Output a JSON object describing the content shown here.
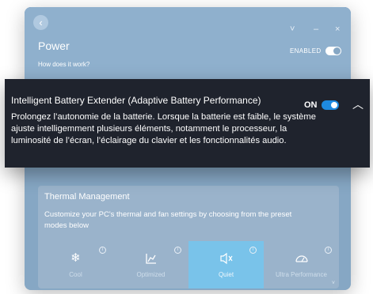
{
  "window": {
    "back_icon": "chevron-left-icon",
    "title": "Power",
    "help_link": "How does it work?",
    "enabled_label": "ENABLED",
    "controls": {
      "collapse": "˅",
      "minimize": "–",
      "close": "×"
    }
  },
  "popup": {
    "title": "Intelligent Battery Extender (Adaptive Battery Performance)",
    "description": "Prolongez l’autonomie de la batterie. Lorsque la batterie est faible, le système ajuste intelligemment plusieurs éléments, notamment le processeur, la luminosité de l’écran, l’éclairage du clavier et les fonctionnalités audio.",
    "toggle_label": "ON",
    "collapse_glyph": "︿"
  },
  "thermal": {
    "title": "Thermal Management",
    "description": "Customize your PC's thermal and fan settings by choosing from the preset modes below",
    "info_glyph": "i",
    "modes": [
      {
        "label": "Cool",
        "icon": "snowflake-icon",
        "glyph": "❄",
        "selected": false
      },
      {
        "label": "Optimized",
        "icon": "chart-icon",
        "glyph": "📈",
        "selected": false
      },
      {
        "label": "Quiet",
        "icon": "speaker-mute-icon",
        "glyph": "🔇",
        "selected": true
      },
      {
        "label": "Ultra Performance",
        "icon": "speedometer-icon",
        "glyph": "⏲",
        "selected": false
      }
    ]
  },
  "colors": {
    "window_bg": "#4d7ea8",
    "popup_bg": "#1f232d",
    "accent": "#1e8ae0",
    "selected_mode": "#3aa7e0"
  }
}
